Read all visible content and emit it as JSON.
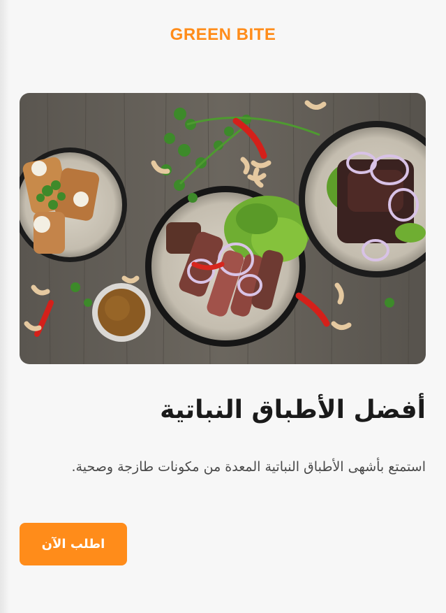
{
  "header": {
    "brand": "GREEN BITE"
  },
  "hero": {
    "image_name": "vegan-dishes-photo"
  },
  "main": {
    "headline": "أفضل الأطباق النباتية",
    "description": "استمتع بأشهى الأطباق النباتية المعدة من مكونات طازجة وصحية.",
    "cta_label": "اطلب الآن"
  },
  "colors": {
    "accent": "#ff8c1a",
    "background": "#f7f7f7",
    "text": "#1a1a1a"
  }
}
